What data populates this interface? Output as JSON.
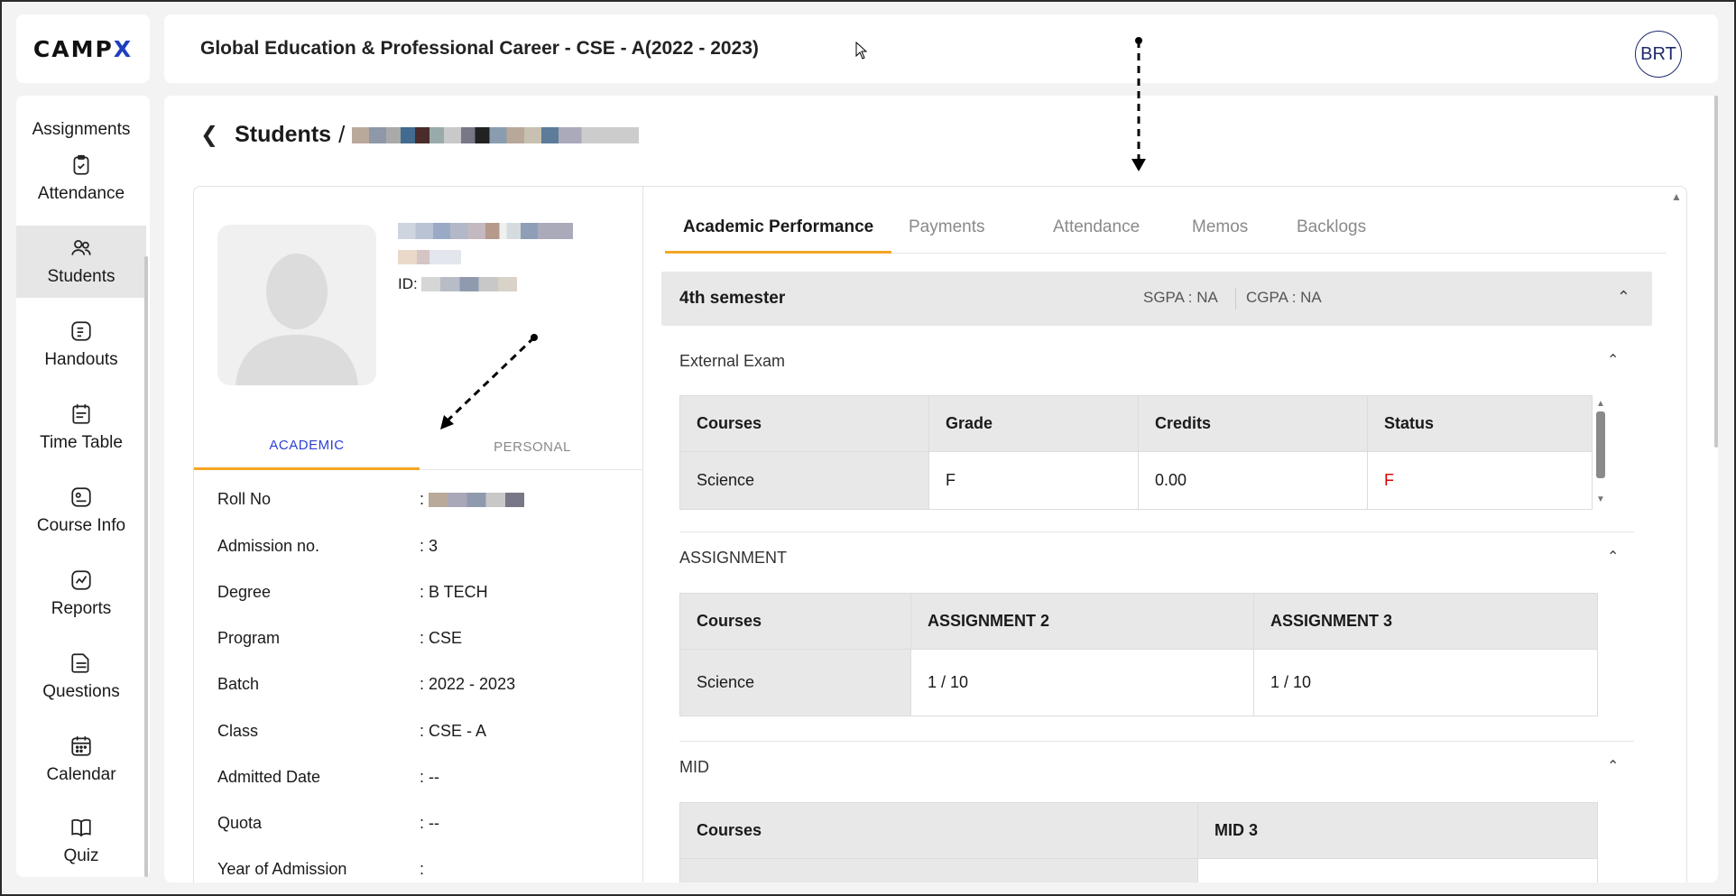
{
  "app": {
    "logo_main": "CAMP",
    "logo_accent": "X"
  },
  "header": {
    "title": "Global Education & Professional Career - CSE - A(2022 - 2023)",
    "avatar": "BRT"
  },
  "sidebar": {
    "items": [
      {
        "label": "Assignments",
        "icon": "assignments-icon"
      },
      {
        "label": "Attendance",
        "icon": "clipboard-check-icon"
      },
      {
        "label": "Students",
        "icon": "users-icon",
        "active": true
      },
      {
        "label": "Handouts",
        "icon": "handouts-icon"
      },
      {
        "label": "Time Table",
        "icon": "timetable-icon"
      },
      {
        "label": "Course Info",
        "icon": "course-info-icon"
      },
      {
        "label": "Reports",
        "icon": "chart-icon"
      },
      {
        "label": "Questions",
        "icon": "folder-icon"
      },
      {
        "label": "Calendar",
        "icon": "calendar-icon"
      },
      {
        "label": "Quiz",
        "icon": "book-icon"
      }
    ]
  },
  "breadcrumb": {
    "section": "Students",
    "separator": "/"
  },
  "profile": {
    "id_label": "ID:",
    "tabs": {
      "academic": "ACADEMIC",
      "personal": "PERSONAL"
    },
    "fields": [
      {
        "key": "Roll No",
        "value": ":"
      },
      {
        "key": "Admission no.",
        "value": ": 3"
      },
      {
        "key": "Degree",
        "value": ": B TECH"
      },
      {
        "key": "Program",
        "value": ": CSE"
      },
      {
        "key": "Batch",
        "value": ": 2022 - 2023"
      },
      {
        "key": "Class",
        "value": ": CSE - A"
      },
      {
        "key": "Admitted Date",
        "value": ": --"
      },
      {
        "key": "Quota",
        "value": ": --"
      },
      {
        "key": "Year of Admission",
        "value": ":"
      }
    ]
  },
  "tabs": [
    "Academic Performance",
    "Payments",
    "Attendance",
    "Memos",
    "Backlogs"
  ],
  "semester": {
    "title": "4th semester",
    "sgpa": "SGPA : NA",
    "cgpa": "CGPA : NA"
  },
  "external": {
    "title": "External Exam",
    "headers": [
      "Courses",
      "Grade",
      "Credits",
      "Status"
    ],
    "rows": [
      [
        "Science",
        "F",
        "0.00",
        "F"
      ]
    ]
  },
  "assignment": {
    "title": "ASSIGNMENT",
    "headers": [
      "Courses",
      "ASSIGNMENT 2",
      "ASSIGNMENT 3"
    ],
    "rows": [
      [
        "Science",
        "1 / 10",
        "1 / 10"
      ]
    ]
  },
  "mid": {
    "title": "MID",
    "headers": [
      "Courses",
      "MID 3"
    ]
  },
  "colors": {
    "accent": "#f5a623",
    "link": "#2d3fd6",
    "fail": "#e00000",
    "brand": "#1d3fbf"
  }
}
